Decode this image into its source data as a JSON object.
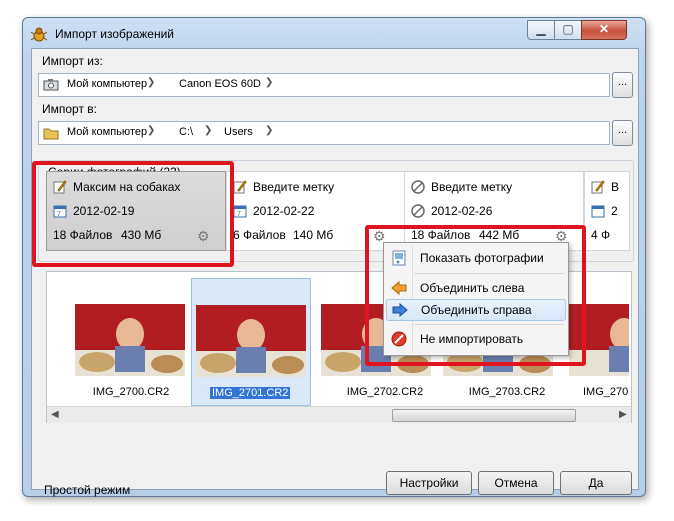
{
  "window": {
    "title": "Импорт изображений"
  },
  "import_from": {
    "label": "Импорт из:",
    "crumbs": [
      "Мой компьютер",
      "Canon EOS 60D"
    ],
    "browse": "..."
  },
  "import_to": {
    "label": "Импорт в:",
    "crumbs": [
      "Мой компьютер",
      "C:\\",
      "Users"
    ],
    "browse": "..."
  },
  "series": {
    "title": "Серии фотографий (23)",
    "cards": [
      {
        "name": "Максим на собаках",
        "date": "2012-02-19",
        "files": "18 Файлов",
        "size": "430 Мб"
      },
      {
        "name": "Введите метку",
        "date": "2012-02-22",
        "files": "6 Файлов",
        "size": "140 Мб"
      },
      {
        "name": "Введите метку",
        "date": "2012-02-26",
        "files": "18 Файлов",
        "size": "442 Мб"
      },
      {
        "name": "В",
        "date": "2",
        "files": "4 Ф",
        "size": ""
      }
    ]
  },
  "thumbnails": [
    {
      "name": "IMG_2700.CR2"
    },
    {
      "name": "IMG_2701.CR2"
    },
    {
      "name": "IMG_2702.CR2"
    },
    {
      "name": "IMG_2703.CR2"
    },
    {
      "name": "IMG_270"
    }
  ],
  "context_menu": {
    "items": [
      "Показать фотографии",
      "Объединить слева",
      "Объединить справа",
      "Не импортировать"
    ],
    "highlighted": "Объединить справа"
  },
  "footer": {
    "mode": "Простой режим",
    "settings": "Настройки",
    "cancel": "Отмена",
    "ok": "Да"
  },
  "colors": {
    "highlight": "#e0141e",
    "selection": "#3375d6"
  }
}
